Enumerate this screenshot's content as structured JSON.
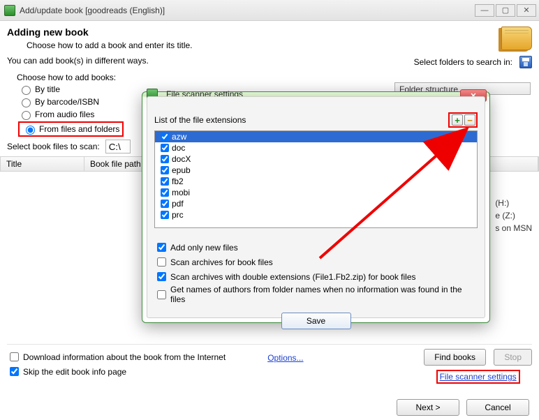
{
  "window": {
    "title": "Add/update book [goodreads (English)]"
  },
  "header": {
    "title": "Adding new book",
    "subtitle": "Choose how to add a book and enter its title."
  },
  "ways_text": "You can add book(s) in different ways.",
  "select_folders_label": "Select folders to search in:",
  "folder_structure_label": "Folder structure",
  "choose_label": "Choose how to add books:",
  "radios": {
    "by_title": "By title",
    "by_barcode": "By barcode/ISBN",
    "from_audio": "From audio files",
    "from_files": "From files and folders"
  },
  "select_files_label": "Select book files to scan:",
  "path_value": "C:\\",
  "table": {
    "col1": "Title",
    "col2": "Book file path"
  },
  "right_drives": {
    "h": "(H:)",
    "z": "e (Z:)",
    "msn": "s on MSN"
  },
  "bottom": {
    "download_info": "Download information about the book from the Internet",
    "skip_edit": "Skip the edit book info page",
    "options": "Options...",
    "find_books": "Find books",
    "stop": "Stop",
    "fs_link": "File scanner settings"
  },
  "footer": {
    "next": "Next >",
    "cancel": "Cancel"
  },
  "modal": {
    "title": "File scanner settings",
    "list_label": "List of the file extensions",
    "extensions": [
      "azw",
      "doc",
      "docX",
      "epub",
      "fb2",
      "mobi",
      "pdf",
      "prc"
    ],
    "checks": {
      "add_only_new": "Add only new files",
      "scan_archives": "Scan archives for book files",
      "scan_double_ext": "Scan archives with double extensions (File1.Fb2.zip) for book files",
      "get_author_names": "Get names of authors from folder names when no information was found in the files"
    },
    "save": "Save"
  }
}
